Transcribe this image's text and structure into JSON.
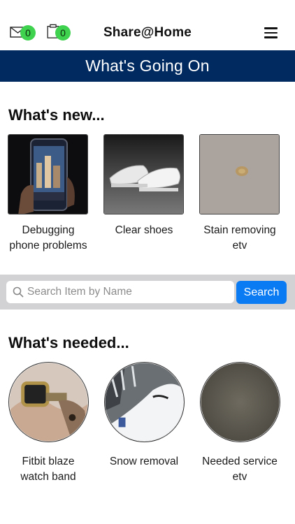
{
  "header": {
    "title": "Share@Home",
    "mail_count": "0",
    "tasks_count": "0",
    "icons": [
      "mail-icon",
      "clipboard-icon",
      "hamburger-menu-icon"
    ]
  },
  "banner": {
    "text": "What's Going On"
  },
  "whats_new": {
    "title": "What's new...",
    "items": [
      {
        "label": "Debugging phone problems",
        "image": "phone-photo"
      },
      {
        "label": "Clear shoes",
        "image": "shoes-photo"
      },
      {
        "label": "Stain removing etv",
        "image": "stain-photo"
      }
    ]
  },
  "search": {
    "placeholder": "Search Item by Name",
    "value": "",
    "button_label": "Search"
  },
  "whats_needed": {
    "title": "What's needed...",
    "items": [
      {
        "label": "Fitbit blaze watch band",
        "image": "watch-photo"
      },
      {
        "label": "Snow removal",
        "image": "snow-photo"
      },
      {
        "label": "Needed service etv",
        "image": "fabric-photo"
      }
    ]
  },
  "colors": {
    "banner_bg": "#012b60",
    "badge": "#3fd24f",
    "search_button": "#0a7bf2",
    "search_band": "#d2d2d4"
  }
}
